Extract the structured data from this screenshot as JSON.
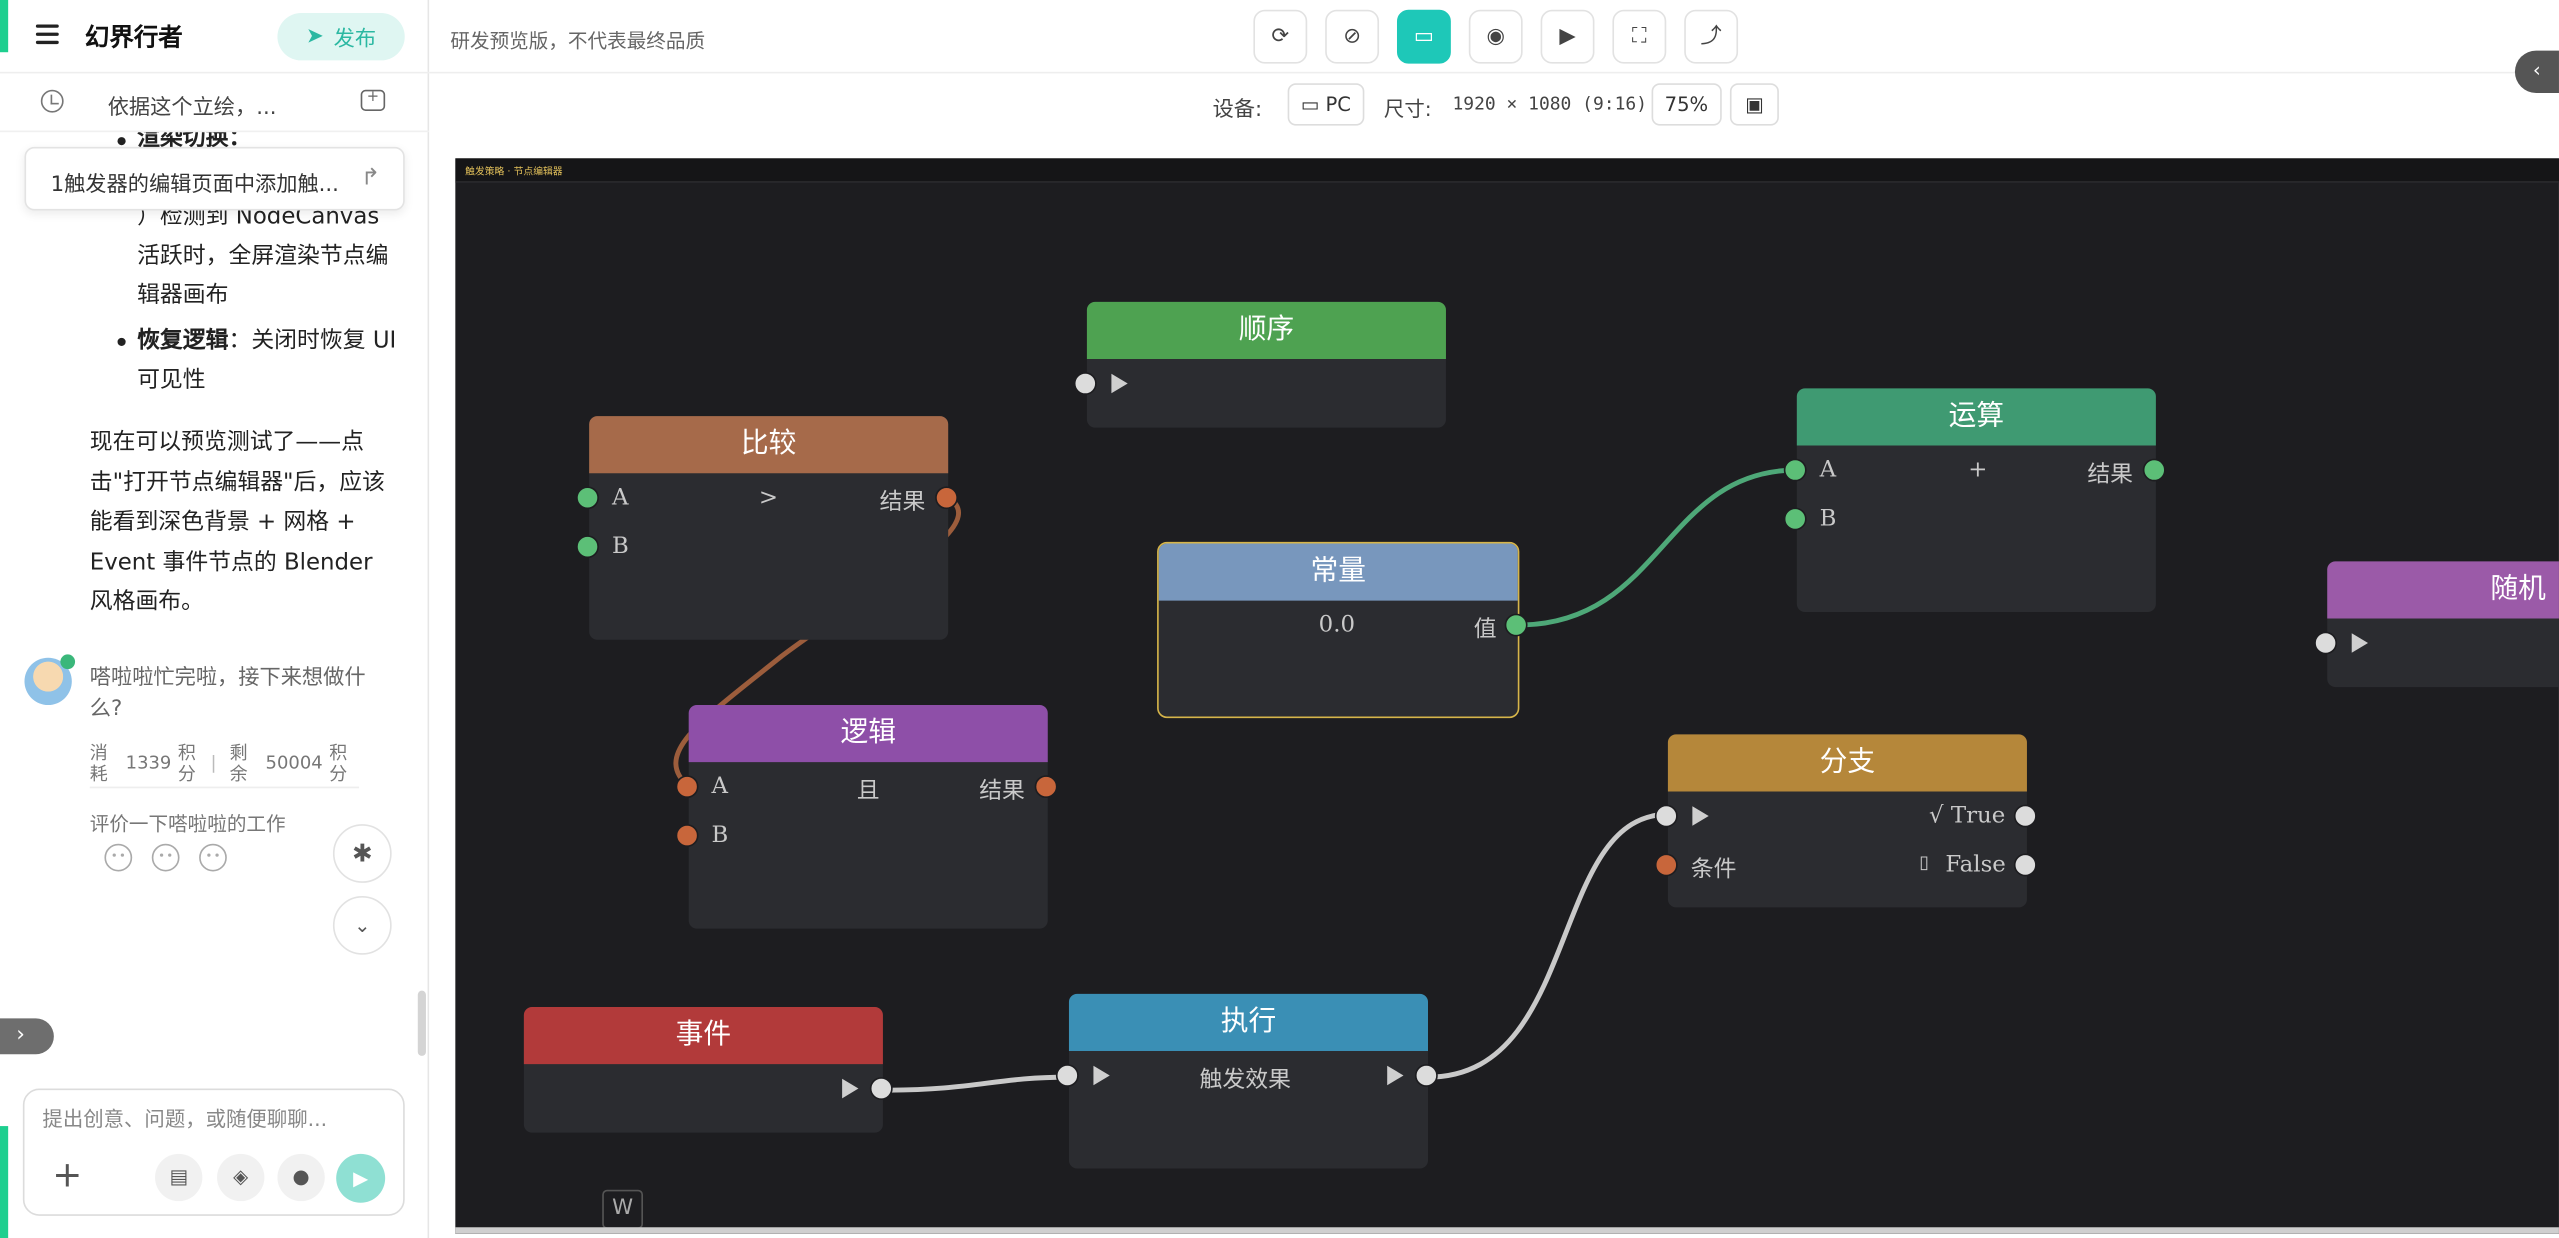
{
  "app": {
    "title": "幻界行者",
    "publish_label": "发布"
  },
  "chat": {
    "title": "依据这个立绘，...",
    "pinned": "1触发器的编辑页面中添加触...",
    "md_partial_top": "渲染切换：",
    "md_line1": "）检测到 NodeCanvas",
    "md_line2": "活跃时，全屏渲染节点编",
    "md_line3": "辑器画布",
    "md_bullet2_bold": "恢复逻辑",
    "md_bullet2_text": "：关闭时恢复 UI",
    "md_bullet2_line2": "可见性",
    "paragraph": "现在可以预览测试了——点击\"打开节点编辑器\"后，应该能看到深色背景 + 网格 + Event 事件节点的 Blender 风格画布。",
    "bot_message": "嗒啦啦忙完啦，接下来想做什么?",
    "stats": {
      "consume_label": "消耗",
      "consume_value": "1339",
      "consume_unit": "积分",
      "remain_label": "剩余",
      "remain_value": "50004",
      "remain_unit": "积分"
    },
    "rate_prompt": "评价一下嗒啦啦的工作",
    "input_placeholder": "提出创意、问题，或随便聊聊..."
  },
  "preview": {
    "note": "研发预览版，不代表最终品质",
    "device_label": "设备:",
    "device_value": "PC",
    "size_label": "尺寸:",
    "size_value": "1920 × 1080 (9:16)",
    "zoom": "75%",
    "canvas_title": "触发策略 · 节点编辑器"
  },
  "nodes": {
    "sequence": {
      "title": "顺序",
      "color": "#4ea251"
    },
    "compare": {
      "title": "比较",
      "color": "#a66a4a",
      "a": "A",
      "b": "B",
      "op": ">",
      "out": "结果"
    },
    "constant": {
      "title": "常量",
      "color": "#7897bd",
      "value": "0.0",
      "out": "值"
    },
    "math": {
      "title": "运算",
      "color": "#3f9a72",
      "a": "A",
      "b": "B",
      "op": "+",
      "out": "结果"
    },
    "random": {
      "title": "随机",
      "color": "#9b5aa8"
    },
    "logic": {
      "title": "逻辑",
      "color": "#8e4fa8",
      "a": "A",
      "b": "B",
      "op": "且",
      "out": "结果"
    },
    "branch": {
      "title": "分支",
      "color": "#b5873a",
      "cond": "条件",
      "true": "√ True",
      "false": "False",
      "false_glyph": "▯"
    },
    "event": {
      "title": "事件",
      "color": "#b23a3a"
    },
    "exec": {
      "title": "执行",
      "color": "#3a8fb5",
      "action": "触发效果"
    }
  },
  "w_key": "W"
}
